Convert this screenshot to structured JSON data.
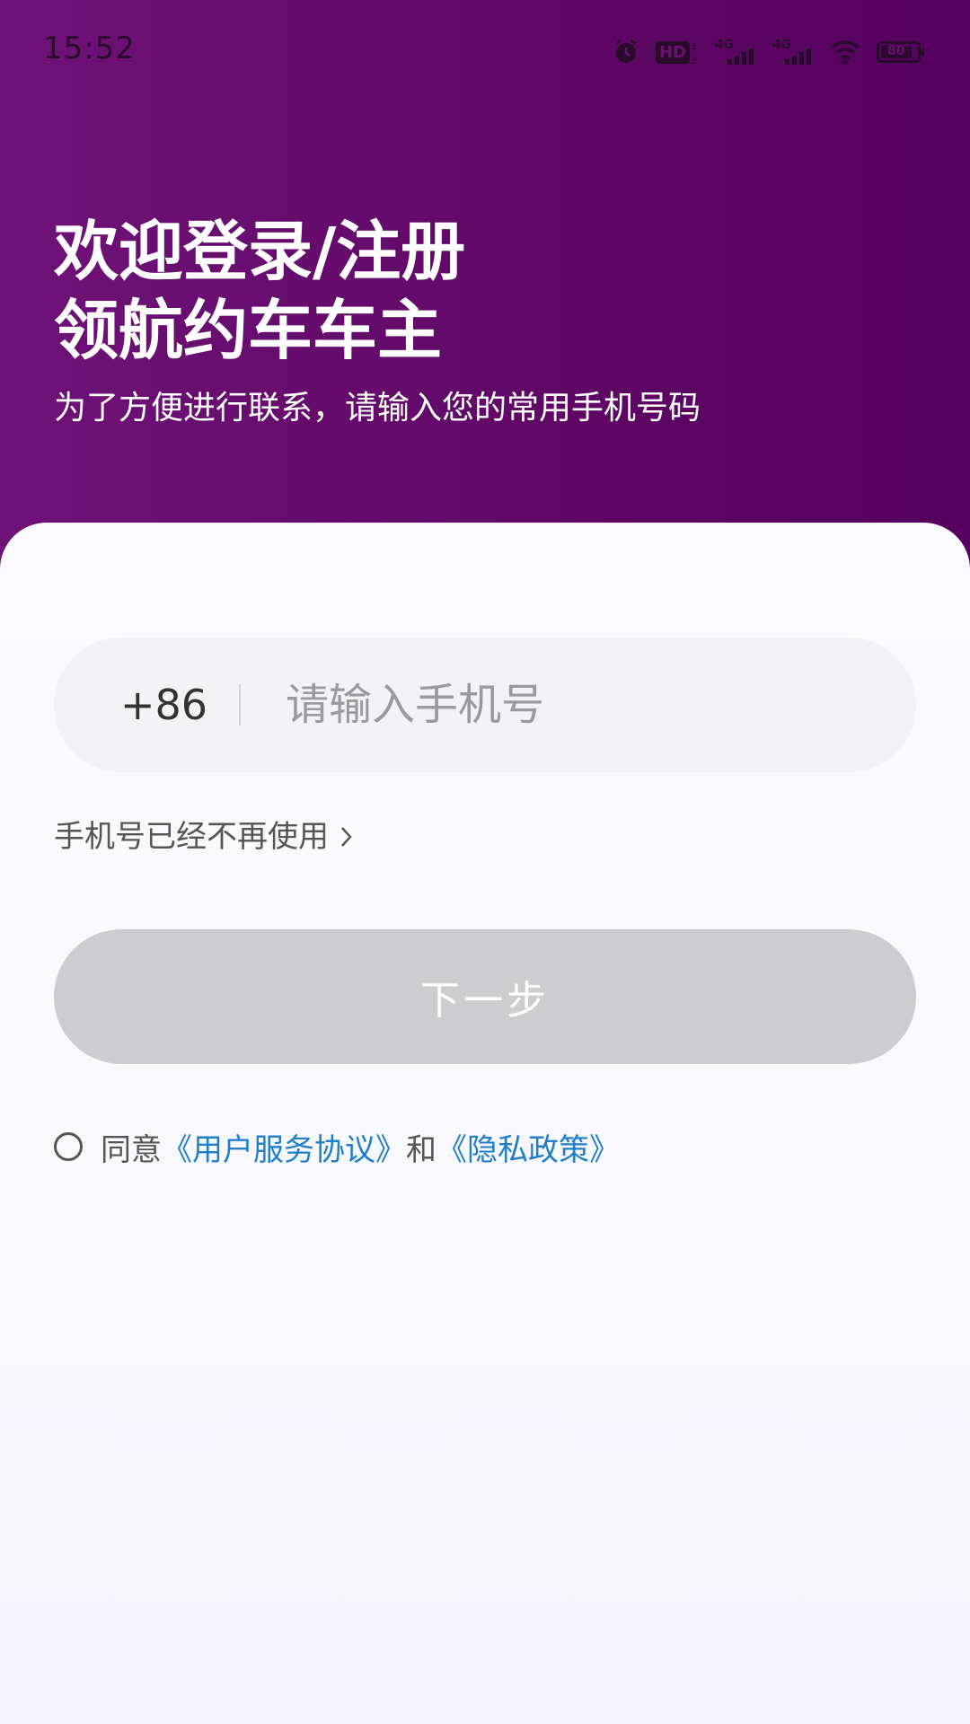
{
  "status_bar": {
    "time": "15:52",
    "icons": [
      "alarm-icon",
      "hd-icon",
      "signal-4g-icon",
      "signal-4g-icon",
      "wifi-icon",
      "battery-icon"
    ],
    "hd_label": "HD",
    "net1_label": "4G",
    "net2_label": "4G",
    "battery_level": "80"
  },
  "header": {
    "title_line1": "欢迎登录/注册",
    "title_line2": "领航约车车主",
    "subtitle": "为了方便进行联系，请输入您的常用手机号码"
  },
  "form": {
    "country_code": "+86",
    "phone_value": "",
    "phone_placeholder": "请输入手机号",
    "unused_link_label": "手机号已经不再使用",
    "next_button_label": "下一步",
    "agree_prefix": "同意",
    "user_agreement": "《用户服务协议》",
    "agree_conjunction": "和",
    "privacy_policy": "《隐私政策》"
  },
  "colors": {
    "header_gradient_start": "#6f1278",
    "header_gradient_end": "#550060",
    "link": "#1f7fc8",
    "button_disabled": "#cdcdcf"
  }
}
